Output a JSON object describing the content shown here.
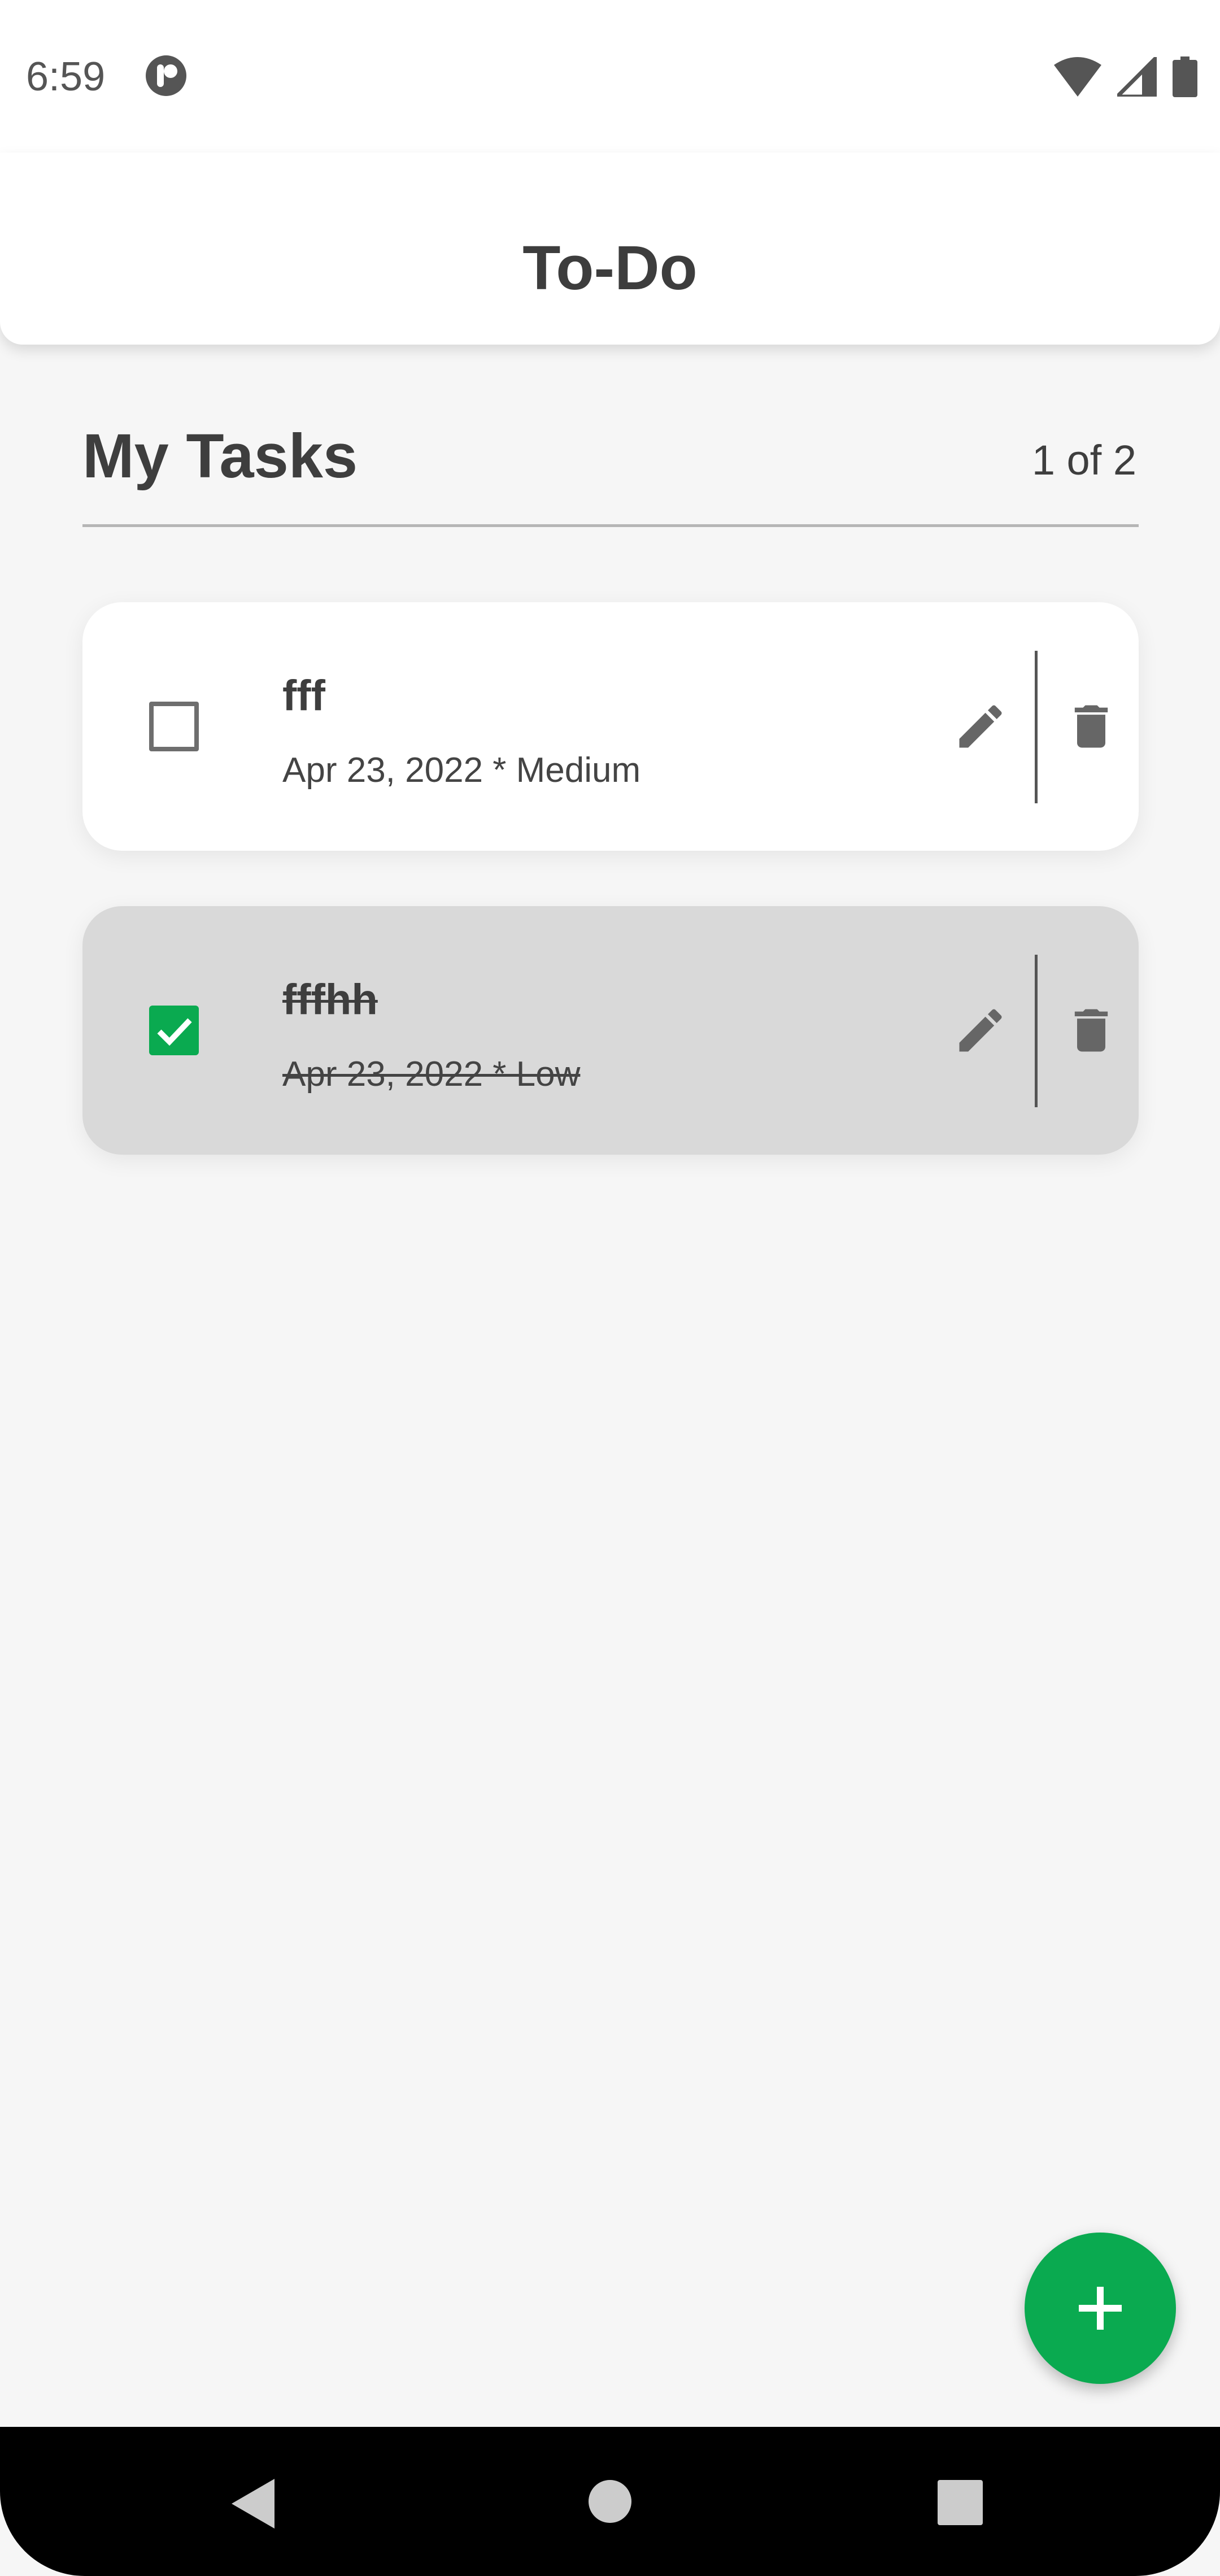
{
  "status_bar": {
    "time": "6:59",
    "icons": [
      "app-notification-icon",
      "wifi-icon",
      "signal-icon",
      "battery-icon"
    ]
  },
  "header": {
    "title": "To-Do"
  },
  "section": {
    "title": "My Tasks",
    "count": "1 of 2"
  },
  "tasks": [
    {
      "title": "fff",
      "meta": "Apr 23, 2022 * Medium",
      "completed": false
    },
    {
      "title": "fffhh",
      "meta": "Apr 23, 2022 * Low",
      "completed": true
    }
  ],
  "icons": {
    "edit": "pencil-icon",
    "delete": "trash-icon",
    "add": "plus-icon"
  },
  "colors": {
    "accent": "#0aaa50",
    "background": "#f6f6f6",
    "completed_card": "#d9d9d9",
    "text": "#3e3e3e"
  }
}
